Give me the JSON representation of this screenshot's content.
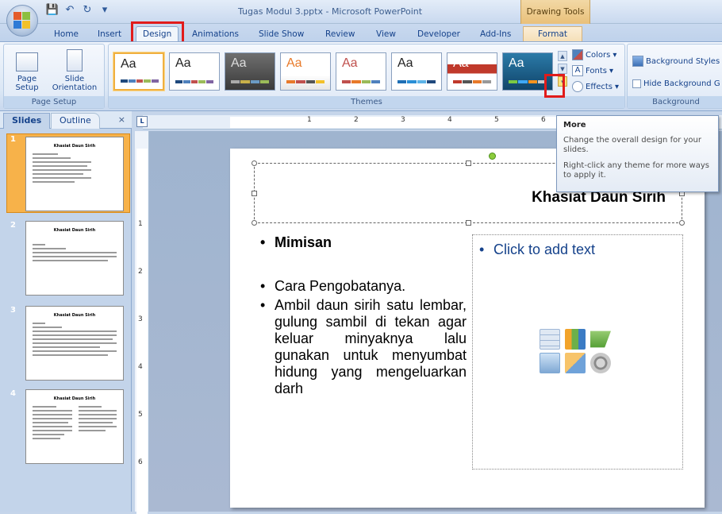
{
  "window": {
    "title": "Tugas Modul 3.pptx - Microsoft PowerPoint",
    "contextual_tab_group": "Drawing Tools"
  },
  "tabs": [
    {
      "label": "Home"
    },
    {
      "label": "Insert"
    },
    {
      "label": "Design",
      "selected": true
    },
    {
      "label": "Animations"
    },
    {
      "label": "Slide Show"
    },
    {
      "label": "Review"
    },
    {
      "label": "View"
    },
    {
      "label": "Developer"
    },
    {
      "label": "Add-Ins"
    },
    {
      "label": "Format"
    }
  ],
  "ribbon": {
    "page_setup": {
      "page_setup_label_1": "Page",
      "page_setup_label_2": "Setup",
      "orientation_label_1": "Slide",
      "orientation_label_2": "Orientation",
      "group_label": "Page Setup"
    },
    "themes": {
      "aa_label": "Aa",
      "group_label": "Themes",
      "colors_label": "Colors",
      "fonts_label": "Fonts",
      "effects_label": "Effects"
    },
    "background": {
      "styles_label": "Background Styles",
      "hide_label": "Hide Background G",
      "group_label": "Background"
    }
  },
  "pane": {
    "slides_tab": "Slides",
    "outline_tab": "Outline",
    "close": "×",
    "thumbnails": [
      {
        "number": "1",
        "title": "Khasiat Daun Sirih"
      },
      {
        "number": "2",
        "title": "Khasiat Daun Sirih"
      },
      {
        "number": "3",
        "title": "Khasiat Daun Sirih"
      },
      {
        "number": "4",
        "title": "Khasiat Daun Sirih"
      }
    ]
  },
  "ruler": {
    "corner": "L",
    "h_numbers": [
      "1",
      "2",
      "3",
      "4",
      "5",
      "6"
    ],
    "v_numbers": [
      "1",
      "2",
      "3",
      "4",
      "5",
      "6"
    ]
  },
  "slide": {
    "title": "Khasiat Daun Sirih",
    "bullets": {
      "mimisan": "Mimisan",
      "cara": "Cara Pengobatanya.",
      "ambil": "Ambil daun sirih satu lembar, gulung sambil di tekan agar keluar minyaknya lalu gunakan untuk menyumbat hidung yang mengeluarkan darh"
    },
    "placeholder": "Click to add text"
  },
  "tooltip": {
    "title": "More",
    "description": "Change the overall design for your slides.",
    "hint": "Right-click any theme for more ways to apply it."
  }
}
